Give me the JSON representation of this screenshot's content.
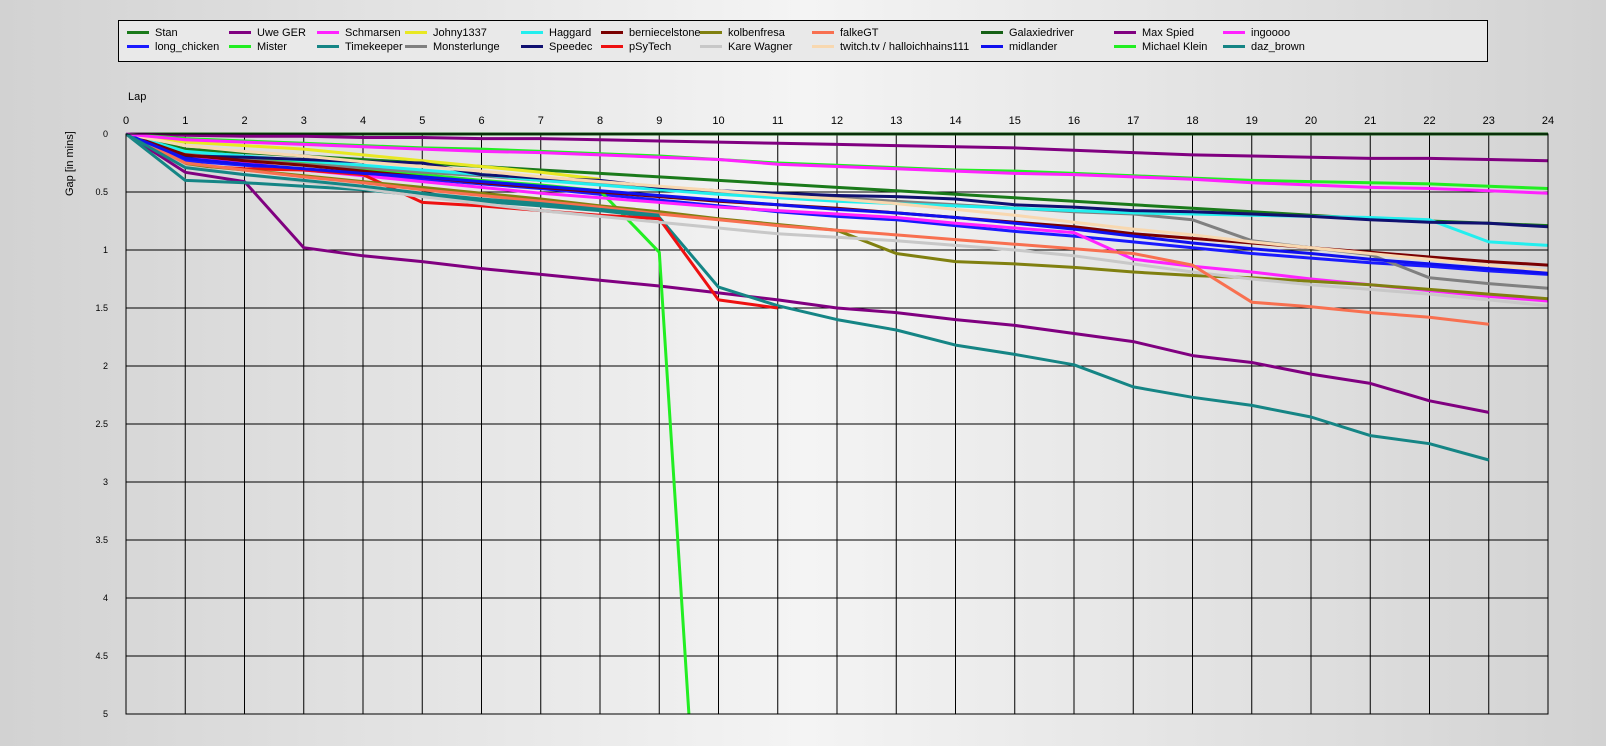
{
  "chart_data": {
    "type": "line",
    "xlabel": "Lap",
    "ylabel": "Gap [in mins]",
    "xlim": [
      0,
      24
    ],
    "ylim": [
      0,
      5
    ],
    "x_ticks": [
      "0",
      "1",
      "2",
      "3",
      "4",
      "5",
      "6",
      "7",
      "8",
      "9",
      "10",
      "11",
      "12",
      "13",
      "14",
      "15",
      "16",
      "17",
      "18",
      "19",
      "20",
      "21",
      "22",
      "23",
      "24"
    ],
    "y_ticks": [
      "0",
      "0.5",
      "1",
      "1.5",
      "2",
      "2.5",
      "3",
      "3.5",
      "4",
      "4.5",
      "5"
    ],
    "grid": true,
    "legend_position": "top",
    "series": [
      {
        "name": "Stan",
        "color": "#1a7a1a",
        "x": [
          0,
          1,
          2,
          3,
          4,
          5,
          6,
          7,
          8,
          9,
          10,
          11,
          12,
          13,
          14,
          15,
          16,
          17,
          18,
          19,
          20,
          21,
          22,
          23,
          24
        ],
        "values": [
          0,
          0.13,
          0.16,
          0.19,
          0.22,
          0.25,
          0.28,
          0.31,
          0.34,
          0.37,
          0.4,
          0.43,
          0.46,
          0.49,
          0.52,
          0.55,
          0.58,
          0.61,
          0.64,
          0.67,
          0.7,
          0.73,
          0.75,
          0.77,
          0.79
        ]
      },
      {
        "name": "long_chicken",
        "color": "#1a1aff",
        "x": [
          0,
          1,
          2,
          3,
          4,
          5,
          6,
          7,
          8,
          9,
          10,
          11,
          12,
          13,
          14,
          15,
          16,
          17,
          18,
          19,
          20,
          21,
          22,
          23,
          24
        ],
        "values": [
          0,
          0.23,
          0.27,
          0.31,
          0.35,
          0.39,
          0.43,
          0.47,
          0.52,
          0.57,
          0.62,
          0.67,
          0.71,
          0.74,
          0.79,
          0.84,
          0.88,
          0.93,
          0.98,
          1.03,
          1.07,
          1.11,
          1.14,
          1.18,
          1.21
        ]
      },
      {
        "name": "Uwe GER",
        "color": "#800080",
        "x": [
          0,
          1,
          2,
          3,
          4,
          5,
          6,
          7,
          8,
          9,
          10,
          11,
          12,
          13,
          14,
          15,
          16,
          17,
          18,
          19,
          20,
          21,
          22,
          23
        ],
        "values": [
          0,
          0.33,
          0.41,
          0.98,
          1.05,
          1.1,
          1.16,
          1.21,
          1.26,
          1.31,
          1.37,
          1.43,
          1.5,
          1.54,
          1.6,
          1.65,
          1.72,
          1.79,
          1.91,
          1.97,
          2.07,
          2.15,
          2.3,
          2.4
        ]
      },
      {
        "name": "Mister",
        "color": "#22ee22",
        "x": [
          0,
          1,
          2,
          3,
          4,
          5,
          6,
          7,
          8,
          9,
          9.5
        ],
        "values": [
          0,
          0.16,
          0.21,
          0.25,
          0.3,
          0.35,
          0.4,
          0.44,
          0.49,
          1.02,
          5.0
        ]
      },
      {
        "name": "Schmarsen",
        "color": "#ff22ff",
        "x": [
          0,
          1,
          2,
          3,
          4,
          5,
          6,
          7,
          8,
          9,
          10,
          11,
          12,
          13,
          14,
          15,
          16,
          17,
          18,
          19,
          20,
          21,
          22,
          23,
          24
        ],
        "values": [
          0,
          0.2,
          0.25,
          0.31,
          0.36,
          0.41,
          0.46,
          0.51,
          0.55,
          0.59,
          0.63,
          0.66,
          0.69,
          0.72,
          0.77,
          0.81,
          0.85,
          1.08,
          1.14,
          1.19,
          1.25,
          1.3,
          1.35,
          1.4,
          1.44
        ]
      },
      {
        "name": "Timekeeper",
        "color": "#158585",
        "x": [
          0,
          1,
          2,
          3,
          4,
          5,
          6,
          7,
          8,
          9,
          10,
          11,
          12,
          13,
          14,
          15,
          16,
          17,
          18,
          19,
          20,
          21,
          22,
          23
        ],
        "values": [
          0,
          0.4,
          0.42,
          0.45,
          0.48,
          0.53,
          0.58,
          0.62,
          0.66,
          0.72,
          1.32,
          1.48,
          1.6,
          1.69,
          1.82,
          1.9,
          1.99,
          2.18,
          2.27,
          2.34,
          2.44,
          2.6,
          2.67,
          2.81
        ]
      },
      {
        "name": "Johny1337",
        "color": "#e8e822",
        "x": [
          0,
          1,
          2,
          3,
          4,
          5,
          6,
          7,
          8
        ],
        "values": [
          0,
          0.07,
          0.1,
          0.13,
          0.18,
          0.23,
          0.28,
          0.33,
          0.39
        ]
      },
      {
        "name": "Monsterlunge",
        "color": "#808080",
        "x": [
          0,
          1,
          2,
          3,
          4,
          5,
          6,
          7,
          8,
          9,
          10,
          11,
          12,
          13,
          14,
          15,
          16,
          17,
          18,
          19,
          20,
          21,
          22,
          23,
          24
        ],
        "values": [
          0,
          0.17,
          0.22,
          0.26,
          0.29,
          0.33,
          0.36,
          0.4,
          0.43,
          0.46,
          0.5,
          0.53,
          0.55,
          0.58,
          0.61,
          0.64,
          0.67,
          0.69,
          0.74,
          0.92,
          0.98,
          1.04,
          1.24,
          1.29,
          1.33
        ]
      },
      {
        "name": "Haggard",
        "color": "#22eeee",
        "x": [
          0,
          1,
          2,
          3,
          4,
          5,
          6,
          7,
          8,
          9,
          10,
          11,
          12,
          13,
          14,
          15,
          16,
          17,
          18,
          19,
          20,
          21,
          22,
          23,
          24
        ],
        "values": [
          0,
          0.15,
          0.19,
          0.23,
          0.27,
          0.31,
          0.35,
          0.4,
          0.44,
          0.48,
          0.52,
          0.55,
          0.58,
          0.6,
          0.62,
          0.64,
          0.66,
          0.68,
          0.69,
          0.7,
          0.71,
          0.72,
          0.74,
          0.93,
          0.96
        ]
      },
      {
        "name": "Speedec",
        "color": "#101070",
        "x": [
          0,
          1,
          2,
          3,
          4,
          5,
          6,
          7,
          8,
          9,
          10,
          11,
          12,
          13,
          14,
          15,
          16,
          17,
          18,
          19,
          20,
          21,
          22,
          23,
          24
        ],
        "values": [
          0,
          0.19,
          0.2,
          0.22,
          0.24,
          0.25,
          0.35,
          0.38,
          0.4,
          0.46,
          0.49,
          0.51,
          0.53,
          0.54,
          0.56,
          0.61,
          0.63,
          0.66,
          0.67,
          0.69,
          0.71,
          0.74,
          0.76,
          0.77,
          0.8
        ]
      },
      {
        "name": "berniecelstone",
        "color": "#7a0000",
        "x": [
          0,
          1,
          2,
          3,
          4,
          5,
          6,
          7,
          8,
          9,
          10,
          11,
          12,
          13,
          14,
          15,
          16,
          17,
          18,
          19,
          20,
          21,
          22,
          23,
          24
        ],
        "values": [
          0,
          0.18,
          0.23,
          0.27,
          0.32,
          0.37,
          0.42,
          0.46,
          0.5,
          0.54,
          0.58,
          0.61,
          0.64,
          0.68,
          0.72,
          0.76,
          0.8,
          0.86,
          0.9,
          0.94,
          0.98,
          1.02,
          1.06,
          1.1,
          1.13
        ]
      },
      {
        "name": "pSyTech",
        "color": "#ee1111",
        "x": [
          0,
          1,
          2,
          3,
          4,
          5,
          6,
          7,
          8,
          9,
          10,
          11
        ],
        "values": [
          0,
          0.27,
          0.3,
          0.31,
          0.35,
          0.59,
          0.62,
          0.66,
          0.7,
          0.73,
          1.43,
          1.5
        ]
      },
      {
        "name": "kolbenfresa",
        "color": "#808010",
        "x": [
          0,
          1,
          2,
          3,
          4,
          5,
          6,
          7,
          8,
          9,
          10,
          11,
          12,
          13,
          14,
          15,
          16,
          17,
          18,
          19,
          20,
          21,
          22,
          23,
          24
        ],
        "values": [
          0,
          0.26,
          0.31,
          0.36,
          0.41,
          0.46,
          0.51,
          0.56,
          0.62,
          0.67,
          0.73,
          0.78,
          0.83,
          1.03,
          1.1,
          1.12,
          1.15,
          1.19,
          1.22,
          1.24,
          1.27,
          1.3,
          1.34,
          1.38,
          1.42
        ]
      },
      {
        "name": "Kare Wagner",
        "color": "#c8c8c8",
        "x": [
          0,
          1,
          2,
          3,
          4,
          5,
          6,
          7,
          8,
          9,
          10,
          11,
          12,
          13,
          14,
          15,
          16,
          17,
          18,
          19,
          20,
          21,
          22,
          23,
          24
        ],
        "values": [
          0,
          0.28,
          0.35,
          0.41,
          0.47,
          0.54,
          0.6,
          0.66,
          0.71,
          0.76,
          0.81,
          0.86,
          0.89,
          0.92,
          0.96,
          1.0,
          1.05,
          1.12,
          1.19,
          1.25,
          1.3,
          1.34,
          1.38,
          1.43,
          1.48
        ]
      },
      {
        "name": "falkeGT",
        "color": "#f87050",
        "x": [
          0,
          1,
          2,
          3,
          4,
          5,
          6,
          7,
          8,
          9,
          10,
          11,
          12,
          13,
          14,
          15,
          16,
          17,
          18,
          19,
          20,
          21,
          22,
          23
        ],
        "values": [
          0,
          0.25,
          0.31,
          0.37,
          0.42,
          0.48,
          0.53,
          0.58,
          0.63,
          0.69,
          0.74,
          0.79,
          0.83,
          0.87,
          0.91,
          0.95,
          0.99,
          1.03,
          1.13,
          1.45,
          1.49,
          1.54,
          1.58,
          1.64
        ]
      },
      {
        "name": "twitch.tv / halloichhains111",
        "color": "#f8d8b0",
        "x": [
          0,
          1,
          2,
          3,
          4,
          5,
          6,
          7,
          8,
          9,
          10,
          11,
          12,
          13,
          14,
          15,
          16,
          17,
          18,
          19,
          20,
          21,
          22,
          23,
          24
        ],
        "values": [
          0,
          0.1,
          0.15,
          0.19,
          0.24,
          0.28,
          0.32,
          0.37,
          0.41,
          0.45,
          0.49,
          0.53,
          0.56,
          0.6,
          0.65,
          0.7,
          0.76,
          0.82,
          0.87,
          0.93,
          0.98,
          1.03,
          1.08,
          1.13,
          1.18
        ]
      },
      {
        "name": "Galaxiedriver",
        "color": "#156015",
        "x": [
          0,
          1,
          2,
          3,
          4,
          5,
          6,
          7,
          8,
          9,
          10,
          11,
          12,
          13,
          14,
          15,
          16,
          17,
          18,
          19,
          20,
          21,
          22,
          23,
          24
        ],
        "values": [
          0,
          0,
          0,
          0,
          0,
          0,
          0,
          0,
          0,
          0,
          0,
          0,
          0,
          0,
          0,
          0,
          0,
          0,
          0,
          0,
          0,
          0,
          0,
          0,
          0
        ]
      },
      {
        "name": "midlander",
        "color": "#1010ee",
        "x": [
          0,
          1,
          2,
          3,
          4,
          5,
          6,
          7,
          8,
          9,
          10,
          11,
          12,
          13,
          14,
          15,
          16,
          17,
          18,
          19,
          20,
          21,
          22,
          23,
          24
        ],
        "values": [
          0,
          0.21,
          0.26,
          0.3,
          0.34,
          0.37,
          0.41,
          0.45,
          0.49,
          0.53,
          0.57,
          0.61,
          0.65,
          0.68,
          0.72,
          0.77,
          0.82,
          0.88,
          0.94,
          0.99,
          1.03,
          1.08,
          1.12,
          1.16,
          1.2
        ]
      },
      {
        "name": "Max Spied",
        "color": "#800080",
        "x": [
          0,
          1,
          2,
          3,
          4,
          5,
          6,
          7,
          8,
          9,
          10,
          11,
          12,
          13,
          14,
          15,
          16,
          17,
          18,
          19,
          20,
          21,
          22,
          23,
          24
        ],
        "values": [
          0,
          0.01,
          0.02,
          0.02,
          0.03,
          0.03,
          0.04,
          0.04,
          0.05,
          0.06,
          0.07,
          0.08,
          0.09,
          0.1,
          0.11,
          0.12,
          0.14,
          0.16,
          0.18,
          0.19,
          0.2,
          0.21,
          0.21,
          0.22,
          0.23
        ]
      },
      {
        "name": "Michael Klein",
        "color": "#22ee22",
        "x": [
          0,
          1,
          2,
          3,
          4,
          5,
          6,
          7,
          8,
          9,
          10,
          11,
          12,
          13,
          14,
          15,
          16,
          17,
          18,
          19,
          20,
          21,
          22,
          23,
          24
        ],
        "values": [
          0,
          0.04,
          0.06,
          0.08,
          0.1,
          0.12,
          0.13,
          0.15,
          0.17,
          0.19,
          0.22,
          0.25,
          0.27,
          0.29,
          0.31,
          0.32,
          0.34,
          0.36,
          0.38,
          0.4,
          0.41,
          0.42,
          0.43,
          0.45,
          0.47
        ]
      },
      {
        "name": "ingoooo",
        "color": "#ff22ff",
        "x": [
          0,
          1,
          2,
          3,
          4,
          5,
          6,
          7,
          8,
          9,
          10,
          11,
          12,
          13,
          14,
          15,
          16,
          17,
          18,
          19,
          20,
          21,
          22,
          23,
          24
        ],
        "values": [
          0,
          0.05,
          0.07,
          0.09,
          0.11,
          0.13,
          0.15,
          0.16,
          0.18,
          0.2,
          0.22,
          0.26,
          0.28,
          0.3,
          0.32,
          0.34,
          0.35,
          0.37,
          0.39,
          0.42,
          0.44,
          0.46,
          0.47,
          0.49,
          0.51
        ]
      },
      {
        "name": "daz_brown",
        "color": "#158585",
        "x": [
          0,
          1,
          2,
          3,
          4,
          5,
          6,
          7,
          8,
          9
        ],
        "values": [
          0,
          0.29,
          0.35,
          0.4,
          0.45,
          0.51,
          0.56,
          0.6,
          0.65,
          0.7
        ]
      }
    ]
  }
}
